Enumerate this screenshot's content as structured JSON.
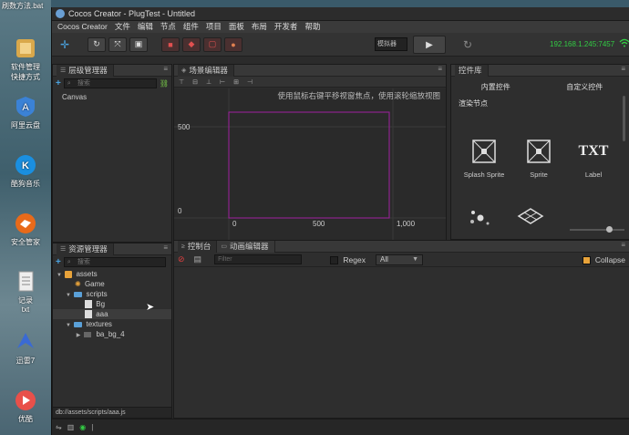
{
  "desktop": {
    "file_label": "刷数方法.bat",
    "icons": [
      {
        "label": "软件管理",
        "label2": "快捷方式",
        "color": "#d9a84b",
        "name": "software-manager-icon"
      },
      {
        "label": "阿里云盘",
        "label2": "",
        "color": "#3b82d6",
        "name": "a-shield-icon"
      },
      {
        "label": "酷狗音乐",
        "label2": "",
        "color": "#1a8fe0",
        "name": "kugou-icon"
      },
      {
        "label": "安全管家",
        "label2": "",
        "color": "#e86a1a",
        "name": "security-icon"
      },
      {
        "label": "记录",
        "label2": "txt",
        "color": "#d8d8d8",
        "name": "text-file-icon"
      },
      {
        "label": "迅雷7",
        "label2": "",
        "color": "#3a6ad4",
        "name": "thunder-icon"
      },
      {
        "label": "优酷",
        "label2": "",
        "color": "#e8504a",
        "name": "play-app-icon"
      }
    ]
  },
  "window": {
    "title": "Cocos Creator - PlugTest - Untitled"
  },
  "menu": [
    "Cocos Creator",
    "文件",
    "编辑",
    "节点",
    "组件",
    "项目",
    "面板",
    "布局",
    "开发者",
    "帮助"
  ],
  "toolbar": {
    "platform": "模拟器",
    "play": "▶",
    "refresh": "↻",
    "ip": "192.168.1.245:7457"
  },
  "hierarchy": {
    "title": "层级管理器",
    "search_placeholder": "搜索",
    "root": "Canvas"
  },
  "assets": {
    "title": "资源管理器",
    "search_placeholder": "搜索",
    "tree": {
      "root": "assets",
      "game": "Game",
      "scripts": "scripts",
      "bg": "Bg",
      "aaa": "aaa",
      "textures": "textures",
      "ba_bg": "ba_bg_4"
    },
    "path": "db://assets/scripts/aaa.js"
  },
  "scene": {
    "title": "场景编辑器",
    "hint": "使用鼠标右键平移视窗焦点，使用滚轮缩放视图",
    "y_labels": [
      "500",
      "0"
    ],
    "x_labels": [
      "0",
      "500",
      "1,000"
    ]
  },
  "library": {
    "title": "控件库",
    "tab_builtin": "内置控件",
    "tab_custom": "自定义控件",
    "section": "渲染节点",
    "items": [
      "Splash Sprite",
      "Sprite",
      "Label"
    ],
    "txt_glyph": "TXT"
  },
  "console": {
    "tab_console": "控制台",
    "tab_anim": "动画编辑器",
    "filter_placeholder": "Filter",
    "regex": "Regex",
    "level": "All",
    "collapse": "Collapse"
  }
}
